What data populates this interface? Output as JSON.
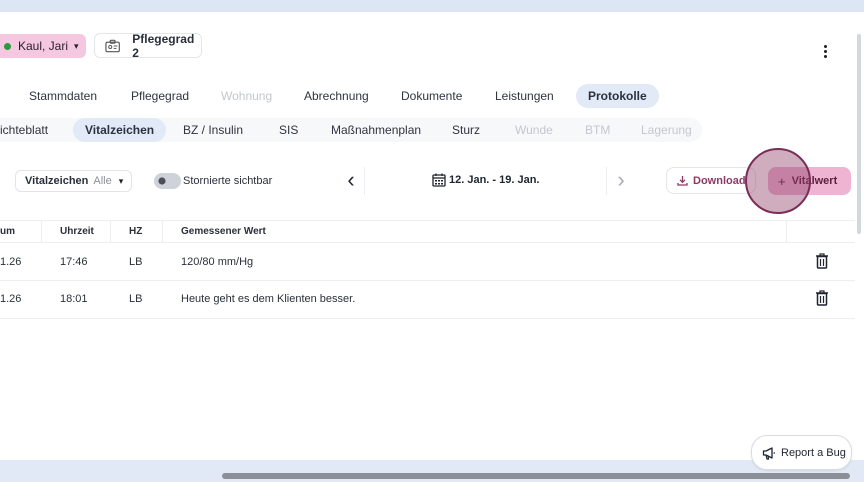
{
  "header": {
    "patient_name": "Kaul, Jari",
    "care_level": "Pflegegrad 2",
    "status_color": "#2b9a3a",
    "accent_color": "#f3c8e0"
  },
  "main_tabs": [
    {
      "label": "Stammdaten",
      "state": "normal"
    },
    {
      "label": "Pflegegrad",
      "state": "normal"
    },
    {
      "label": "Wohnung",
      "state": "disabled"
    },
    {
      "label": "Abrechnung",
      "state": "normal"
    },
    {
      "label": "Dokumente",
      "state": "normal"
    },
    {
      "label": "Leistungen",
      "state": "normal"
    },
    {
      "label": "Protokolle",
      "state": "active"
    }
  ],
  "sub_tabs": [
    {
      "label": "ichteblatt",
      "state": "normal"
    },
    {
      "label": "Vitalzeichen",
      "state": "active"
    },
    {
      "label": "BZ / Insulin",
      "state": "normal"
    },
    {
      "label": "SIS",
      "state": "normal"
    },
    {
      "label": "Maßnahmenplan",
      "state": "normal"
    },
    {
      "label": "Sturz",
      "state": "normal"
    },
    {
      "label": "Wunde",
      "state": "disabled"
    },
    {
      "label": "BTM",
      "state": "disabled"
    },
    {
      "label": "Lagerung",
      "state": "disabled"
    }
  ],
  "toolbar": {
    "filter_label": "Vitalzeichen",
    "filter_value": "Alle",
    "toggle_label": "Stornierte sichtbar",
    "toggle_on": false,
    "date_range": "12. Jan. - 19. Jan.",
    "download_label": "Download",
    "add_label": "Vitalwert",
    "add_color": "#eeb4d1"
  },
  "table": {
    "columns": [
      "um",
      "Uhrzeit",
      "HZ",
      "Gemessener Wert"
    ],
    "rows": [
      {
        "date": "1.26",
        "time": "17:46",
        "hz": "LB",
        "value": "120/80 mm/Hg"
      },
      {
        "date": "1.26",
        "time": "18:01",
        "hz": "LB",
        "value": "Heute geht es dem Klienten besser."
      }
    ]
  },
  "report_bug_label": "Report a Bug",
  "icons": {
    "caret": "▾",
    "prev": "‹",
    "next": "›",
    "plus": "+"
  }
}
